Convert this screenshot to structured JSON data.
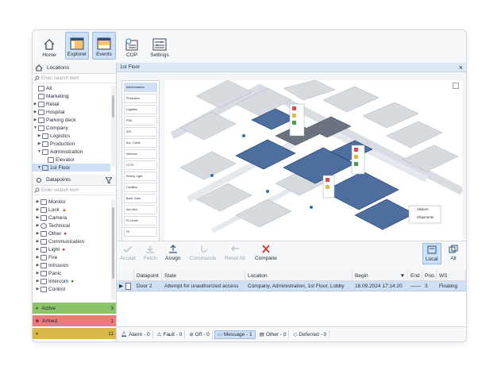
{
  "toolbar": {
    "buttons": [
      {
        "label": "Home",
        "icon": "home-icon",
        "active": false
      },
      {
        "label": "Explorer",
        "icon": "explorer-icon",
        "active": true
      },
      {
        "label": "Events",
        "icon": "events-icon",
        "active": true
      },
      {
        "label": "COP",
        "icon": "cop-icon",
        "active": false
      },
      {
        "label": "Settings",
        "icon": "settings-icon",
        "active": false
      }
    ]
  },
  "locations": {
    "title": "Locations",
    "search_placeholder": "Enter search term",
    "items": [
      {
        "label": "All",
        "indent": 0,
        "arrow": ""
      },
      {
        "label": "Marketing",
        "indent": 0,
        "arrow": ""
      },
      {
        "label": "Retail",
        "indent": 0,
        "arrow": "▶"
      },
      {
        "label": "Hospital",
        "indent": 0,
        "arrow": "▶"
      },
      {
        "label": "Parking deck",
        "indent": 0,
        "arrow": "▶"
      },
      {
        "label": "Company",
        "indent": 0,
        "arrow": "▼"
      },
      {
        "label": "Logistics",
        "indent": 1,
        "arrow": "▶"
      },
      {
        "label": "Production",
        "indent": 1,
        "arrow": "▶"
      },
      {
        "label": "Administration",
        "indent": 1,
        "arrow": "▼"
      },
      {
        "label": "Elevator",
        "indent": 2,
        "arrow": ""
      },
      {
        "label": "1st Floor",
        "indent": 2,
        "arrow": "▼",
        "selected": true
      }
    ]
  },
  "datapoints": {
    "title": "Datapoints",
    "search_placeholder": "Enter search term",
    "items": [
      {
        "label": "Monitor"
      },
      {
        "label": "Lock"
      },
      {
        "label": "Camera"
      },
      {
        "label": "Technical"
      },
      {
        "label": "Other"
      },
      {
        "label": "Communication"
      },
      {
        "label": "Light"
      },
      {
        "label": "Fire"
      },
      {
        "label": "Intrusion"
      },
      {
        "label": "Panic"
      },
      {
        "label": "Intercom"
      },
      {
        "label": "Control"
      }
    ]
  },
  "status": {
    "active": {
      "label": "Active",
      "count": "3",
      "color": "#8dc46b"
    },
    "armed": {
      "label": "Armed",
      "count": "1",
      "color": "#e97b7b"
    },
    "other": {
      "count": "11",
      "color": "#d8b84a"
    }
  },
  "view": {
    "title": "1st Floor",
    "close": "×"
  },
  "legend": [
    "Administration",
    "Production",
    "Logistics",
    "PSA",
    "IDS",
    "Acc. Cards",
    "Intercom",
    "CCTV",
    "Emerg. Light",
    "Facilities",
    "Build. Data",
    "Alm Mon.",
    "FI-Center",
    "Fit"
  ],
  "map_labels": {
    "visitors": "Visitors",
    "shipments": "Shipments"
  },
  "actions": [
    {
      "label": "Accept",
      "enabled": false
    },
    {
      "label": "Fetch",
      "enabled": false
    },
    {
      "label": "Assign",
      "enabled": true
    },
    {
      "label": "Commands",
      "enabled": false
    },
    {
      "label": "Reset All",
      "enabled": false
    },
    {
      "label": "Complete",
      "enabled": true
    }
  ],
  "view_toggle": {
    "local": "Local",
    "all": "All"
  },
  "table": {
    "headers": [
      "Datapoint",
      "State",
      "Location",
      "Begin",
      "End",
      "Prio.",
      "WS"
    ],
    "rows": [
      {
        "datapoint": "Door 2",
        "state": "Attempt for unauthorized access",
        "location": "Company, Administration, 1st Floor, Lobby",
        "begin": "16.09.2024 17:14:20",
        "end": "——",
        "prio": "3",
        "ws": "Floating"
      }
    ]
  },
  "filters": [
    {
      "label": "Alarm - 0",
      "icon": "bell-icon"
    },
    {
      "label": "Fault - 0",
      "icon": "warning-icon"
    },
    {
      "label": "Off - 0",
      "icon": "off-icon"
    },
    {
      "label": "Message - 1",
      "icon": "message-icon",
      "active": true
    },
    {
      "label": "Other - 0",
      "icon": "other-icon"
    },
    {
      "label": "Deferred - 0",
      "icon": "deferred-icon"
    }
  ],
  "colors": {
    "accent": "#cfe0f4",
    "building_blue": "#4d6f9f",
    "header_blue": "#dde8f5"
  }
}
